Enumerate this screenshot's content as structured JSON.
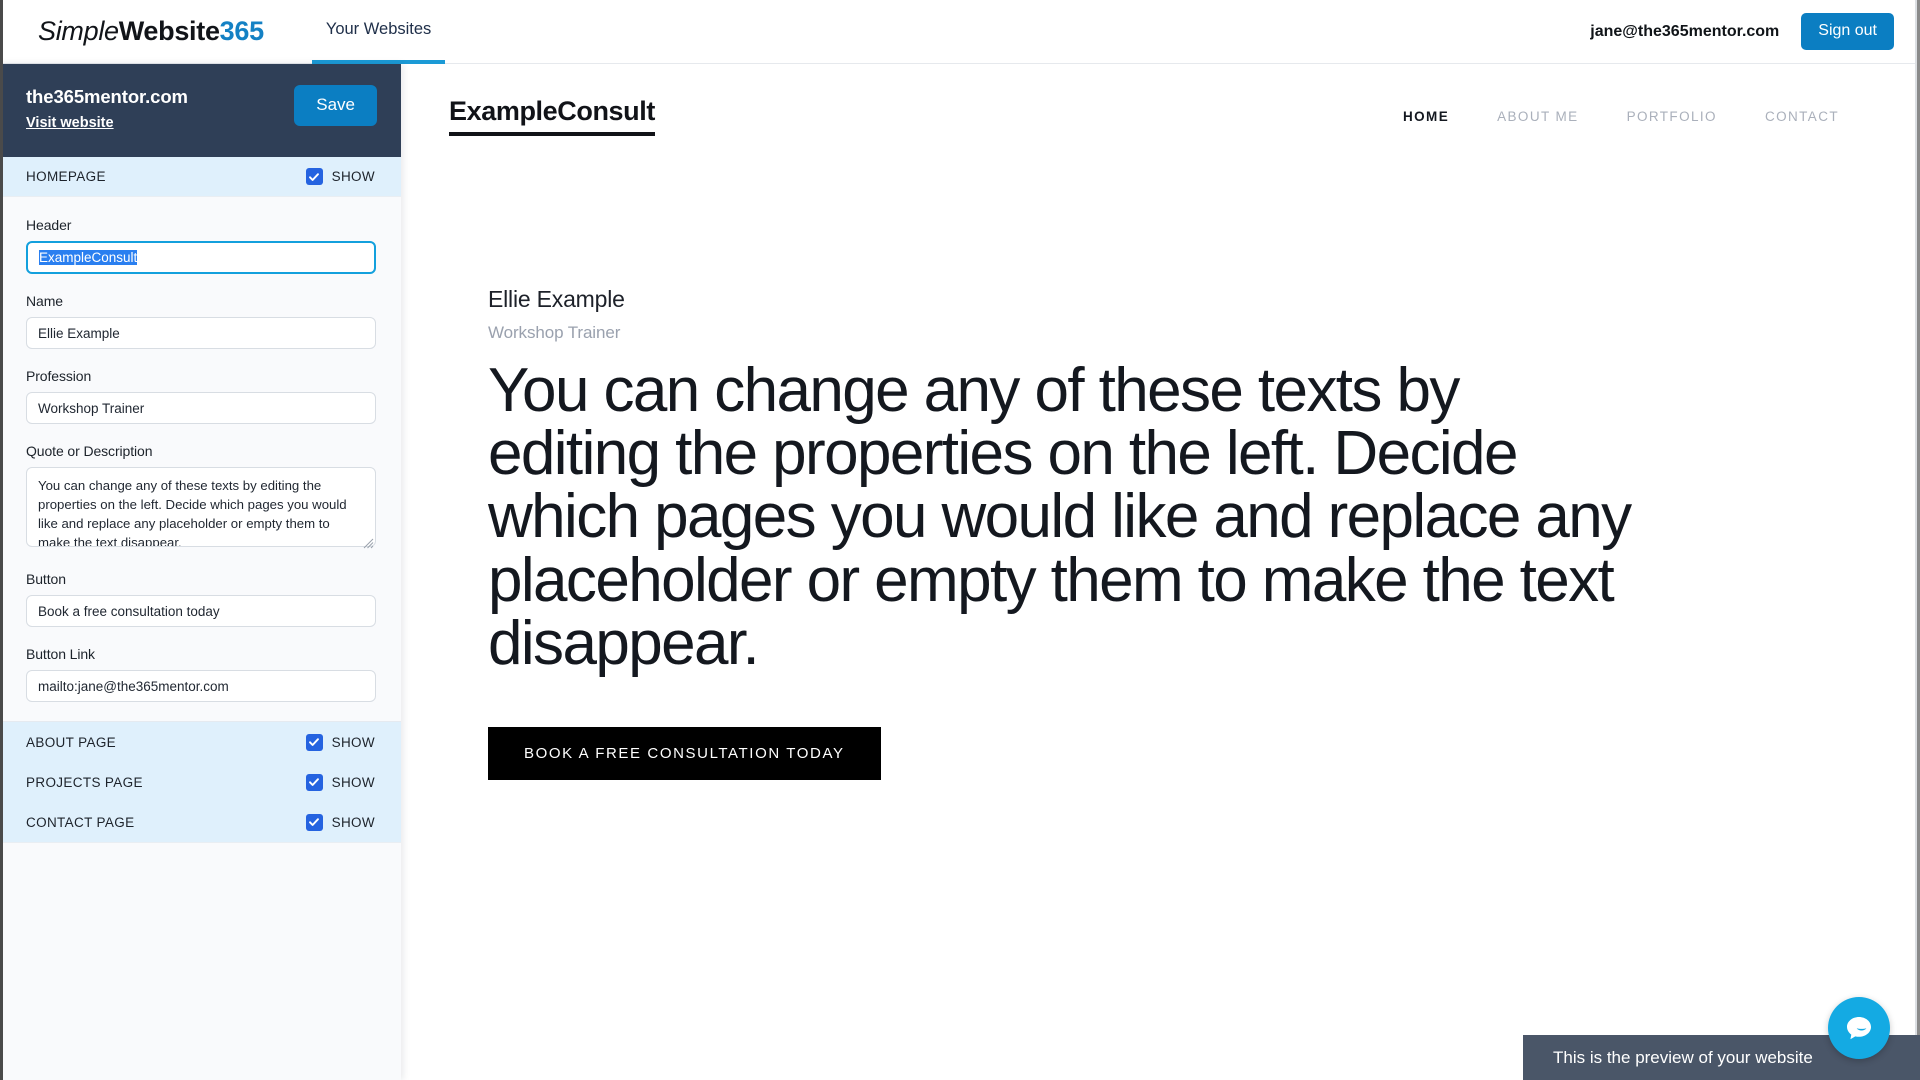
{
  "appbar": {
    "brand": {
      "part1": "Simple",
      "part2": "Website",
      "part3": "365"
    },
    "tabs": [
      {
        "label": "Your Websites",
        "active": true
      }
    ],
    "user_email": "jane@the365mentor.com",
    "signout_label": "Sign out",
    "accent_color": "#1b9ad6",
    "button_color": "#0b7ec2"
  },
  "sidebar": {
    "domain": "the365mentor.com",
    "visit_link": "Visit website",
    "save_label": "Save",
    "homepage_section": {
      "title": "HOMEPAGE",
      "show_label": "SHOW",
      "checked": true
    },
    "fields": [
      {
        "label": "Header",
        "value": "ExampleConsult",
        "focused": true,
        "selected": true
      },
      {
        "label": "Name",
        "value": "Ellie Example",
        "focused": false
      },
      {
        "label": "Profession",
        "value": "Workshop Trainer",
        "focused": false
      },
      {
        "label": "Quote or Description",
        "value": "You can change any of these texts by editing the properties on the left. Decide which pages you would like and replace any placeholder or empty them to make the text disappear.",
        "type": "textarea"
      },
      {
        "label": "Button",
        "value": "Book a free consultation today",
        "focused": false
      },
      {
        "label": "Button Link",
        "value": "mailto:jane@the365mentor.com",
        "focused": false
      }
    ],
    "pages": [
      {
        "title": "ABOUT PAGE",
        "show_label": "SHOW",
        "checked": true
      },
      {
        "title": "PROJECTS PAGE",
        "show_label": "SHOW",
        "checked": true
      },
      {
        "title": "CONTACT PAGE",
        "show_label": "SHOW",
        "checked": true
      }
    ],
    "header_bg": "#2f3f57",
    "section_bg": "#dff0fc",
    "checkbox_color": "#2563e0"
  },
  "preview": {
    "logo": "ExampleConsult",
    "menu": [
      {
        "label": "HOME",
        "active": true
      },
      {
        "label": "ABOUT ME",
        "active": false
      },
      {
        "label": "PORTFOLIO",
        "active": false
      },
      {
        "label": "CONTACT",
        "active": false
      }
    ],
    "name": "Ellie Example",
    "profession": "Workshop Trainer",
    "quote": "You can change any of these texts by editing the properties on the left. Decide which pages you would like and replace any placeholder or empty them to make the text disappear.",
    "cta_label": "BOOK A FREE CONSULTATION TODAY",
    "cta_bg": "#000000"
  },
  "overlay": {
    "tooltip": "This is the preview of your website",
    "tooltip_bg": "#4a5668",
    "chat_icon": "chat-bubble-icon",
    "chat_color": "#14aae3"
  }
}
